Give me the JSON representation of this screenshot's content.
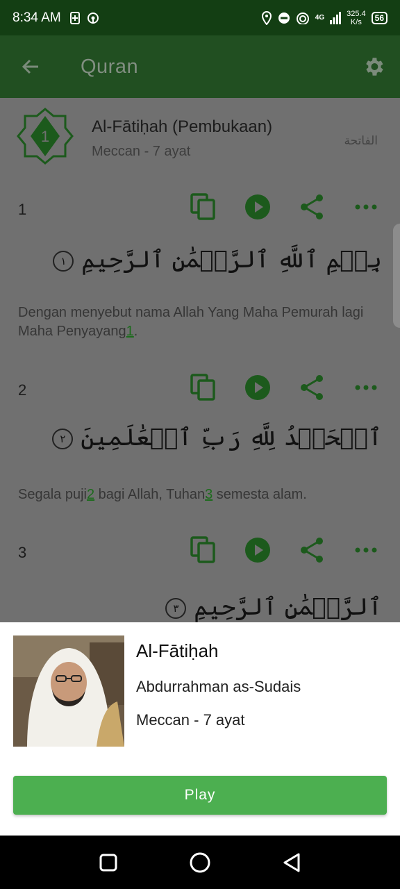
{
  "status_bar": {
    "time": "8:34 AM",
    "network": "4G",
    "speed_value": "325.4",
    "speed_unit": "K/s",
    "battery": "56"
  },
  "app_bar": {
    "title": "Quran"
  },
  "surah": {
    "number": "1",
    "name": "Al-Fātiḥah (Pembukaan)",
    "meta": "Meccan - 7 ayat",
    "arabic_name": "الفاتحة"
  },
  "verses": [
    {
      "number": "1",
      "arabic": "بِسۡمِ ٱللَّهِ ٱلرَّحۡمَٰنِ ٱلرَّحِيمِ",
      "ayah_mark": "١",
      "translation_parts": [
        "Dengan menyebut nama Allah Yang Maha Pemurah lagi Maha Penyayang",
        "1",
        "."
      ]
    },
    {
      "number": "2",
      "arabic": "ٱلۡحَمۡدُ لِلَّهِ رَبِّ ٱلۡعَٰلَمِينَ",
      "ayah_mark": "٢",
      "translation_parts": [
        "Segala puji",
        "2",
        " bagi Allah, Tuhan",
        "3",
        " semesta alam."
      ]
    },
    {
      "number": "3",
      "arabic": "ٱلرَّحۡمَٰنِ ٱلرَّحِيمِ",
      "ayah_mark": "٣"
    }
  ],
  "player": {
    "title": "Al-Fātiḥah",
    "reciter": "Abdurrahman as-Sudais",
    "meta": "Meccan - 7 ayat",
    "play_label": "Play"
  },
  "colors": {
    "status_bar": "#133e13",
    "app_bar": "#214f21",
    "accent_dimmed": "#1c6b1c",
    "play_button": "#4caf50",
    "scrim": "#707070"
  }
}
